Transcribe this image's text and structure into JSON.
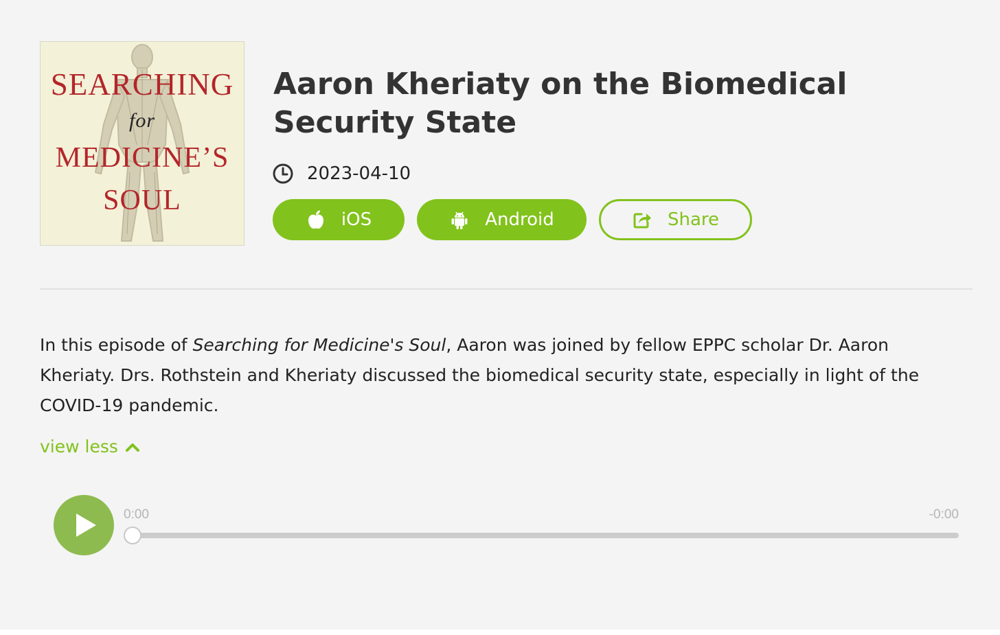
{
  "cover": {
    "line1": "SEARCHING",
    "line2": "for",
    "line3": "MEDICINE’S",
    "line4": "SOUL"
  },
  "episode": {
    "title": "Aaron Kheriaty on the Biomedical Security State",
    "date": "2023-04-10"
  },
  "buttons": {
    "ios": "iOS",
    "android": "Android",
    "share": "Share"
  },
  "description": {
    "prefix": "In this episode of ",
    "show_name": "Searching for Medicine's Soul",
    "suffix": ", Aaron was joined by fellow EPPC scholar Dr. Aaron Kheriaty. Drs. Rothstein and Kheriaty discussed the biomedical security state, especially in light of the COVID-19 pandemic."
  },
  "toggle": {
    "label": "view less"
  },
  "player": {
    "current_time": "0:00",
    "remaining_time": "-0:00",
    "progress": 0
  },
  "icons": {
    "date": "clock-icon",
    "ios": "apple-icon",
    "android": "android-icon",
    "share": "share-icon",
    "toggle": "chevron-up-icon",
    "player": "play-icon"
  },
  "colors": {
    "accent": "#82c21c",
    "play_button": "#8dbb4f",
    "cover_text": "#b3262a",
    "background": "#f4f4f4"
  }
}
